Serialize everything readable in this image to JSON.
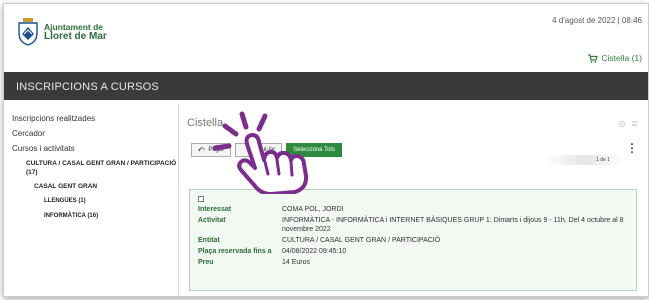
{
  "header": {
    "logo_line1": "Ajuntament de",
    "logo_line2": "Lloret de Mar",
    "datetime": "4 d'agost de 2022 | 08:46",
    "cart_label": "Cistella (1)"
  },
  "topbar": {
    "title": "INSCRIPCIONS A CURSOS"
  },
  "sidebar": {
    "items": [
      {
        "label": "Inscripcions realitzades"
      },
      {
        "label": "Cercador"
      },
      {
        "label": "Cursos i activitats"
      }
    ],
    "category": "CULTURA / CASAL GENT GRAN / PARTICIPACIÓ (17)",
    "subcategory": "CASAL GENT GRAN",
    "leaves": [
      {
        "label": "LLENGÜES (1)"
      },
      {
        "label": "INFORMÀTICA (16)"
      }
    ]
  },
  "main": {
    "title": "Cistella",
    "buttons": {
      "pay": "Pagar",
      "cancel": "Anul·lar",
      "select_all": "Selecciona Tots"
    },
    "pager": "1 de 1",
    "card": {
      "rows": [
        {
          "key": "Interessat",
          "value": "COMA POL, JORDI"
        },
        {
          "key": "Activitat",
          "value": "INFORMÀTICA - INFORMÀTICA i INTERNET BÀSIQUES GRUP 1: Dimarts i dijous 9 - 11h. Del 4 octubre al 8 novembre 2022"
        },
        {
          "key": "Entitat",
          "value": "CULTURA / CASAL GENT GRAN / PARTICIPACIÓ"
        },
        {
          "key": "Plaça reservada fins a",
          "value": "04/08/2022 09:45:10"
        },
        {
          "key": "Preu",
          "value": "14 Euros"
        }
      ]
    }
  },
  "colors": {
    "accent": "#2e8b3e",
    "topbar": "#3a3a3a",
    "cursor": "#7b2d8e"
  },
  "icons": [
    "shield-logo-icon",
    "cart-icon",
    "back-arrow-icon",
    "help-icon",
    "list-icon",
    "kebab-menu-icon",
    "hand-pointer-icon"
  ]
}
